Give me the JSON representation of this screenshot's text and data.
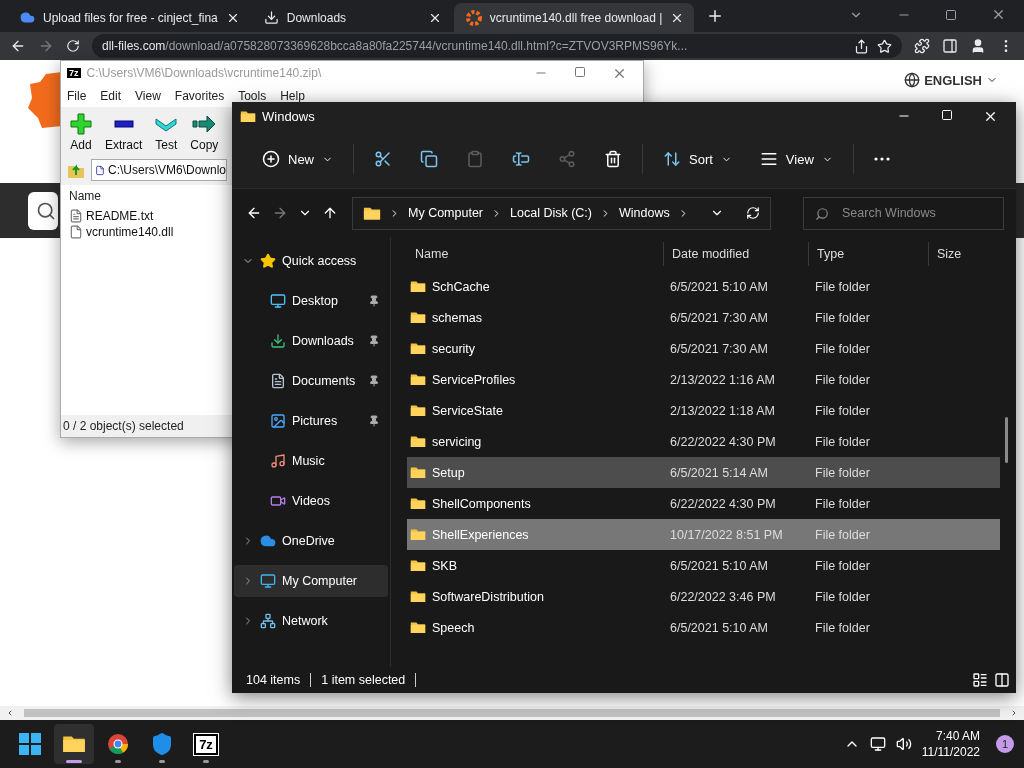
{
  "browser": {
    "tabs": [
      {
        "title": "Upload files for free - cinject_fina",
        "kind": "upload",
        "selected": false
      },
      {
        "title": "Downloads",
        "kind": "download",
        "selected": false
      },
      {
        "title": "vcruntime140.dll free download |",
        "kind": "site",
        "selected": true
      }
    ],
    "url_host": "dll-files.com",
    "url_path": "/download/a075828073369628bcca8a80fa225744/vcruntime140.dll.html?c=ZTVOV3RPMS96Yk...",
    "language": "ENGLISH"
  },
  "zip_window": {
    "app_badge": "7z",
    "title": "C:\\Users\\VM6\\Downloads\\vcruntime140.zip\\",
    "menu": [
      "File",
      "Edit",
      "View",
      "Favorites",
      "Tools",
      "Help"
    ],
    "toolbar": [
      {
        "label": "Add",
        "kind": "add"
      },
      {
        "label": "Extract",
        "kind": "extract"
      },
      {
        "label": "Test",
        "kind": "test"
      },
      {
        "label": "Copy",
        "kind": "copy"
      }
    ],
    "path": "C:\\Users\\VM6\\Downlo",
    "column": "Name",
    "files": [
      {
        "name": "README.txt",
        "kind": "text"
      },
      {
        "name": "vcruntime140.dll",
        "kind": "dll"
      }
    ],
    "status": "0 / 2 object(s) selected"
  },
  "explorer": {
    "title": "Windows",
    "commands": [
      {
        "label": "New",
        "kind": "new",
        "disabled": false
      },
      {
        "kind": "cut",
        "disabled": false
      },
      {
        "kind": "copy",
        "disabled": false
      },
      {
        "kind": "paste",
        "disabled": true
      },
      {
        "kind": "rename",
        "disabled": false
      },
      {
        "kind": "share",
        "disabled": true
      },
      {
        "kind": "delete",
        "disabled": false
      },
      {
        "label": "Sort",
        "kind": "sort",
        "disabled": false
      },
      {
        "label": "View",
        "kind": "view",
        "disabled": false
      },
      {
        "kind": "more",
        "disabled": false
      }
    ],
    "breadcrumb": [
      "My Computer",
      "Local Disk (C:)",
      "Windows"
    ],
    "search": {
      "placeholder": "Search Windows"
    },
    "columns": [
      "Name",
      "Date modified",
      "Type",
      "Size"
    ],
    "nav": [
      {
        "label": "Quick access",
        "kind": "star",
        "expanded": true,
        "selected": false,
        "children": [
          {
            "label": "Desktop",
            "kind": "desktop",
            "pinned": true,
            "selected": false
          },
          {
            "label": "Downloads",
            "kind": "download",
            "pinned": true,
            "selected": false
          },
          {
            "label": "Documents",
            "kind": "document",
            "pinned": true,
            "selected": false
          },
          {
            "label": "Pictures",
            "kind": "picture",
            "pinned": true,
            "selected": false
          },
          {
            "label": "Music",
            "kind": "music",
            "pinned": false,
            "selected": false
          },
          {
            "label": "Videos",
            "kind": "video",
            "pinned": false,
            "selected": false
          }
        ]
      },
      {
        "label": "OneDrive",
        "kind": "cloud",
        "expanded": false,
        "selected": false
      },
      {
        "label": "My Computer",
        "kind": "computer",
        "expanded": false,
        "selected": true
      },
      {
        "label": "Network",
        "kind": "network",
        "expanded": false,
        "selected": false
      }
    ],
    "rows": [
      {
        "name": "SchCache",
        "date": "6/5/2021 5:10 AM",
        "type": "File folder",
        "hovered": false,
        "selected": false
      },
      {
        "name": "schemas",
        "date": "6/5/2021 7:30 AM",
        "type": "File folder",
        "hovered": false,
        "selected": false
      },
      {
        "name": "security",
        "date": "6/5/2021 7:30 AM",
        "type": "File folder",
        "hovered": false,
        "selected": false
      },
      {
        "name": "ServiceProfiles",
        "date": "2/13/2022 1:16 AM",
        "type": "File folder",
        "hovered": false,
        "selected": false
      },
      {
        "name": "ServiceState",
        "date": "2/13/2022 1:18 AM",
        "type": "File folder",
        "hovered": false,
        "selected": false
      },
      {
        "name": "servicing",
        "date": "6/22/2022 4:30 PM",
        "type": "File folder",
        "hovered": false,
        "selected": false
      },
      {
        "name": "Setup",
        "date": "6/5/2021 5:14 AM",
        "type": "File folder",
        "hovered": true,
        "selected": false
      },
      {
        "name": "ShellComponents",
        "date": "6/22/2022 4:30 PM",
        "type": "File folder",
        "hovered": false,
        "selected": false
      },
      {
        "name": "ShellExperiences",
        "date": "10/17/2022 8:51 PM",
        "type": "File folder",
        "hovered": false,
        "selected": true
      },
      {
        "name": "SKB",
        "date": "6/5/2021 5:10 AM",
        "type": "File folder",
        "hovered": false,
        "selected": false
      },
      {
        "name": "SoftwareDistribution",
        "date": "6/22/2022 3:46 PM",
        "type": "File folder",
        "hovered": false,
        "selected": false
      },
      {
        "name": "Speech",
        "date": "6/5/2021 5:10 AM",
        "type": "File folder",
        "hovered": false,
        "selected": false
      }
    ],
    "status": {
      "count": "104 items",
      "selection": "1 item selected"
    }
  },
  "taskbar": {
    "apps": [
      {
        "kind": "start",
        "selected": false,
        "running": false
      },
      {
        "kind": "explorer",
        "selected": true,
        "running": true
      },
      {
        "kind": "chrome",
        "selected": false,
        "running": true
      },
      {
        "kind": "security",
        "selected": false,
        "running": true
      },
      {
        "kind": "sevenzip",
        "label": "7z",
        "selected": false,
        "running": true
      }
    ],
    "time": "7:40 AM",
    "date": "11/11/2022",
    "notifications": "1"
  }
}
